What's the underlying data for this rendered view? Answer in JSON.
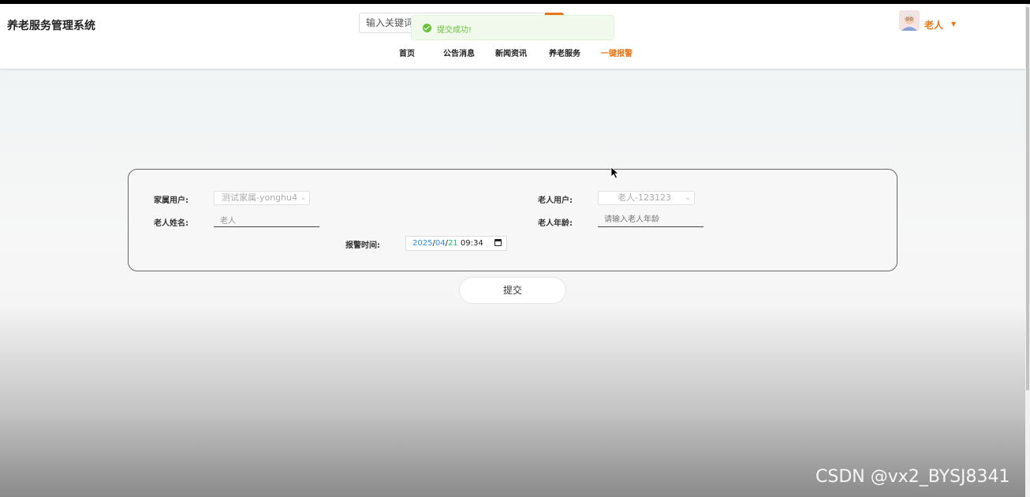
{
  "app": {
    "title": "养老服务管理系统"
  },
  "search": {
    "placeholder": "输入关键词"
  },
  "nav": {
    "items": [
      {
        "label": "首页"
      },
      {
        "label": "公告消息"
      },
      {
        "label": "新闻资讯"
      },
      {
        "label": "养老服务"
      },
      {
        "label": "一键报警"
      }
    ],
    "active": "一键报警"
  },
  "user": {
    "name": "老人",
    "avatar_icon": "elderly-avatar-icon",
    "caret_icon": "caret-down-icon"
  },
  "toast": {
    "text": "提交成功!",
    "icon": "success-check-icon"
  },
  "form": {
    "family_user_label": "家属用户:",
    "family_user_value": "测试家属-yonghu4",
    "elder_user_label": "老人用户:",
    "elder_user_value": "老人-123123",
    "elder_name_label": "老人姓名:",
    "elder_name_value": "老人",
    "elder_age_label": "老人年龄:",
    "elder_age_placeholder": "请输入老人年龄",
    "alarm_time_label": "报警时间:",
    "alarm_time": {
      "year": "2025",
      "month": "04",
      "day": "21",
      "time": "09:34",
      "sep": "/"
    },
    "submit_label": "提交"
  },
  "watermark": "CSDN @vx2_BYSJ8341",
  "colors": {
    "accent": "#e8761a",
    "success": "#67c23a"
  }
}
